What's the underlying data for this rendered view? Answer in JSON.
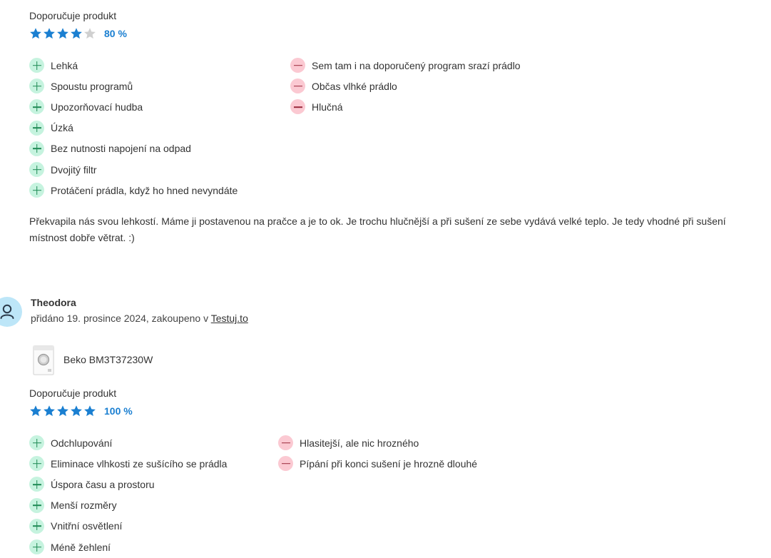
{
  "review1": {
    "recommend_label": "Doporučuje produkt",
    "rating_percent_label": "80 %",
    "stars_filled": 4,
    "stars_total": 5,
    "pros": [
      "Lehká",
      "Spoustu programů",
      "Upozorňovací hudba",
      "Úzká",
      "Bez nutnosti napojení na odpad",
      "Dvojitý filtr",
      "Protáčení prádla, když ho hned nevyndáte"
    ],
    "cons": [
      "Sem tam i na doporučený program srazí prádlo",
      "Občas vlhké prádlo",
      "Hlučná"
    ],
    "text": "Překvapila nás svou lehkostí. Máme ji postavenou na pračce a je to ok. Je trochu hlučnější a při sušení ze sebe vydává velké teplo. Je tedy vhodné při sušení místnost dobře větrat. :)"
  },
  "review2": {
    "author": "Theodora",
    "meta_prefix": "přidáno 19. prosince 2024, zakoupeno v ",
    "shop_link": "Testuj.to",
    "product_name": "Beko BM3T37230W",
    "recommend_label": "Doporučuje produkt",
    "rating_percent_label": "100 %",
    "stars_filled": 5,
    "stars_total": 5,
    "pros": [
      "Odchlupování",
      "Eliminace vlhkosti ze sušícího se prádla",
      "Úspora času a prostoru",
      "Menší rozměry",
      "Vnitřní osvětlení",
      "Méně žehlení"
    ],
    "cons": [
      "Hlasitejší, ale nic hrozného",
      "Pípání při konci sušení je hrozně dlouhé"
    ]
  },
  "colors": {
    "star_filled": "#1a7fd1",
    "star_empty": "#d0d0d0",
    "pro_bg": "#c6f3df",
    "con_bg": "#fbc9d2",
    "avatar_bg": "#bde6f8"
  },
  "icons": {
    "pro": "plus-icon",
    "con": "minus-icon",
    "avatar": "user-icon",
    "star": "star-icon"
  }
}
